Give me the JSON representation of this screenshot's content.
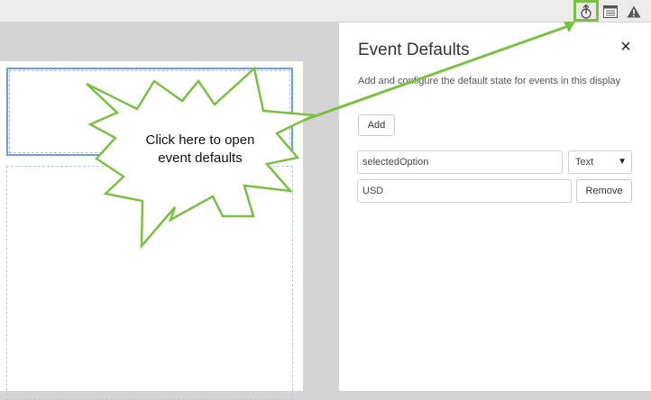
{
  "toolbar": {
    "icons": [
      "event-defaults-icon",
      "list-icon",
      "warning-icon"
    ],
    "highlight_color": "#7bc043"
  },
  "panel": {
    "title": "Event Defaults",
    "close_label": "×",
    "description": "Add and configure the default state for events in this display",
    "add_label": "Add",
    "event_row": {
      "name_value": "selectedOption",
      "type_value": "Text",
      "default_value": "USD",
      "remove_label": "Remove"
    }
  },
  "callout": {
    "line1": "Click here to open",
    "line2": "event defaults",
    "color": "#7bc043"
  }
}
